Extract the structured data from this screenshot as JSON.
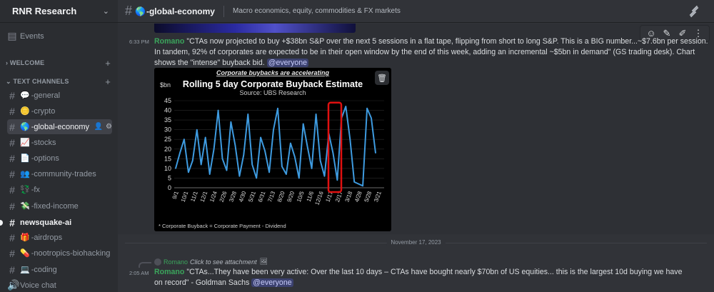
{
  "server": {
    "name": "RNR Research"
  },
  "sidebar": {
    "events_label": "Events",
    "categories": {
      "welcome": "WELCOME",
      "text_channels": "TEXT CHANNELS"
    },
    "channels": [
      {
        "emoji": "💬",
        "label": "-general"
      },
      {
        "emoji": "🪙",
        "label": "-crypto"
      },
      {
        "emoji": "🌎",
        "label": "-global-economy"
      },
      {
        "emoji": "📈",
        "label": "-stocks"
      },
      {
        "emoji": "📄",
        "label": "-options"
      },
      {
        "emoji": "👥",
        "label": "-community-trades"
      },
      {
        "emoji": "💱",
        "label": "-fx"
      },
      {
        "emoji": "💸",
        "label": "-fixed-income"
      },
      {
        "emoji": "",
        "label": "newsquake-ai"
      },
      {
        "emoji": "🎁",
        "label": "-airdrops"
      },
      {
        "emoji": "💊",
        "label": "-nootropics-biohacking"
      },
      {
        "emoji": "💻",
        "label": "-coding"
      }
    ],
    "voice_label": "Voice chat"
  },
  "header": {
    "emoji": "🌎",
    "channel": "-global-economy",
    "topic": "Macro economics, equity, commodities & FX markets"
  },
  "messages": {
    "first": {
      "time": "6:33 PM",
      "author": "Romano",
      "text": "\"CTAs now projected to buy +$38bn S&P over the next 5 sessions in a flat tape, flipping from short to long S&P. This is a BIG number...~$7.6bn per session. In tandem, 92% of corporates are expected to be in their open window by the end of this week, adding an incremental ~$5bn in demand\" (GS trading desk). Chart shows the \"intense\" buyback bid.",
      "mention": "@everyone"
    },
    "date_divider": "November 17, 2023",
    "second": {
      "reply_author": "Romano",
      "reply_text": "Click to see attachment",
      "time": "2:05 AM",
      "author": "Romano",
      "text": "\"CTAs...They have been very active: Over the last 10 days – CTAs have bought nearly $70bn of US equities... this is the largest 10d buying we have on record\" - Goldman Sachs",
      "mention": "@everyone"
    }
  },
  "chart_data": {
    "type": "line",
    "header": "Corporate buybacks are accelerating",
    "title": "Rolling 5 day Corporate Buyback Estimate",
    "subtitle": "Source: UBS Research",
    "ylabel": "$bn",
    "ylim": [
      0,
      45
    ],
    "yticks": [
      0,
      5,
      10,
      15,
      20,
      25,
      30,
      35,
      40,
      45
    ],
    "xticks": [
      "9/1",
      "10/1",
      "11/1",
      "12/1",
      "1/24",
      "2/26",
      "3/28",
      "4/30",
      "5/31",
      "6/31",
      "7/13",
      "8/20",
      "9/20",
      "10/5",
      "11/6",
      "12/16",
      "1/17",
      "2/17",
      "3/18",
      "4/28",
      "5/28",
      "3/21"
    ],
    "series": [
      {
        "values": [
          10,
          18,
          25,
          8,
          14,
          30,
          12,
          26,
          7,
          20,
          40,
          15,
          9,
          34,
          22,
          6,
          17,
          38,
          12,
          5,
          26,
          19,
          8,
          30,
          41,
          11,
          7,
          23,
          16,
          5,
          33,
          21,
          10,
          38,
          14,
          6,
          28,
          18,
          4,
          36,
          42,
          25,
          3,
          2,
          1,
          41,
          36,
          18
        ]
      }
    ],
    "footnote": "* Corporate Buyback = Corporate Payment - Dividend",
    "highlight_color": "#e01010",
    "line_color": "#3e9be0"
  },
  "colors": {
    "author": "#3ba55c",
    "mention_bg": "#3c4270"
  }
}
